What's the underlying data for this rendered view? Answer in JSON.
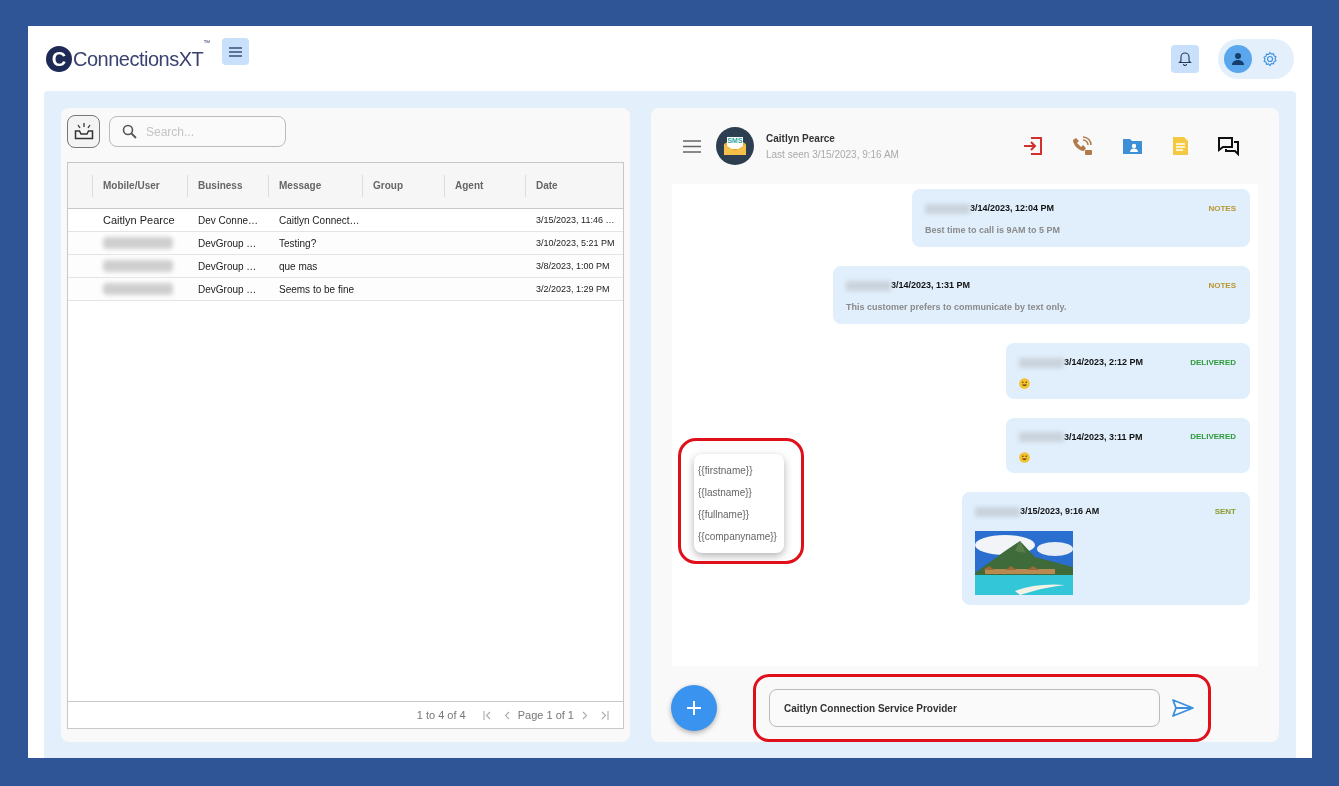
{
  "header": {
    "logo_mark": "C",
    "logo_text": "ConnectionsXT",
    "logo_tm": "™"
  },
  "inbox": {
    "search": {
      "placeholder": "Search..."
    },
    "table": {
      "columns": [
        "Mobile/User",
        "Business",
        "Message",
        "Group",
        "Agent",
        "Date"
      ],
      "rows": [
        {
          "user": "Caitlyn Pearce",
          "user_redacted": false,
          "business": "Dev Conne…",
          "message": "Caitlyn Connect…",
          "date": "3/15/2023, 11:46 …"
        },
        {
          "user_redacted": true,
          "business": "DevGroup …",
          "message": "Testing?",
          "date": "3/10/2023, 5:21 PM"
        },
        {
          "user_redacted": true,
          "business": "DevGroup …",
          "message": "que mas",
          "date": "3/8/2023, 1:00 PM"
        },
        {
          "user_redacted": true,
          "business": "DevGroup …",
          "message": "Seems to be fine",
          "date": "3/2/2023, 1:29 PM"
        }
      ]
    },
    "pagination": {
      "summary": "1 to 4 of 4",
      "page": "Page 1 of 1"
    }
  },
  "chat": {
    "contact": {
      "avatar_label": "SMS",
      "name": "Caitlyn Pearce",
      "last_seen": "Last seen 3/15/2023, 9:16 AM"
    },
    "messages": [
      {
        "kind": "text",
        "time": "3/14/2023, 12:04 PM",
        "status": "NOTES",
        "color": "#b8962e",
        "body": "Best time to call is 9AM to 5 PM"
      },
      {
        "kind": "text",
        "time": "3/14/2023, 1:31 PM",
        "status": "NOTES",
        "color": "#b8962e",
        "body": "This customer prefers to communicate by text only."
      },
      {
        "kind": "emoji",
        "time": "3/14/2023, 2:12 PM",
        "status": "DELIVERED",
        "color": "#2e9a3a"
      },
      {
        "kind": "emoji",
        "time": "3/14/2023, 3:11 PM",
        "status": "DELIVERED",
        "color": "#2e9a3a"
      },
      {
        "time": "3/15/2023, 9:16 AM",
        "status": "SENT",
        "color": "#8c9a2a"
      }
    ],
    "templates": [
      "{{firstname}}",
      "{{lastname}}",
      "{{fullname}}",
      "{{companyname}}"
    ],
    "composer": {
      "value": "Caitlyn Connection Service Provider"
    }
  }
}
